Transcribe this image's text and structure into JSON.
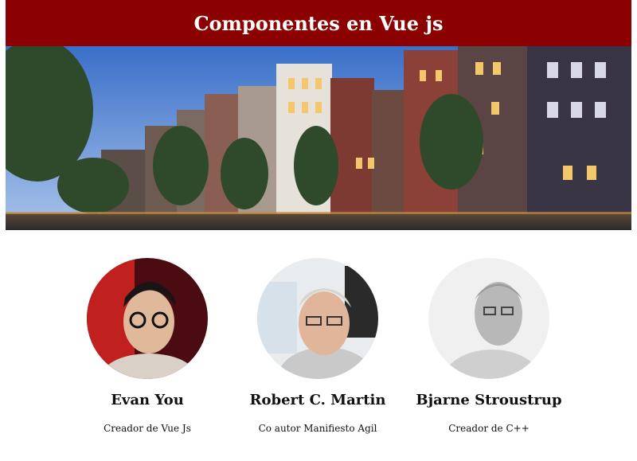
{
  "header": {
    "title": "Componentes en Vue js"
  },
  "hero": {
    "image": "amsterdam-canal-houses-photo"
  },
  "profiles": [
    {
      "name": "Evan You",
      "role": "Creador de Vue Js",
      "avatar": "evan-you-photo"
    },
    {
      "name": "Robert C. Martin",
      "role": "Co autor Manifiesto Agil",
      "avatar": "robert-martin-photo"
    },
    {
      "name": "Bjarne Stroustrup",
      "role": "Creador de C++",
      "avatar": "bjarne-stroustrup-photo"
    }
  ],
  "colors": {
    "header_bg": "#8b0000",
    "header_text": "#ffffff"
  }
}
